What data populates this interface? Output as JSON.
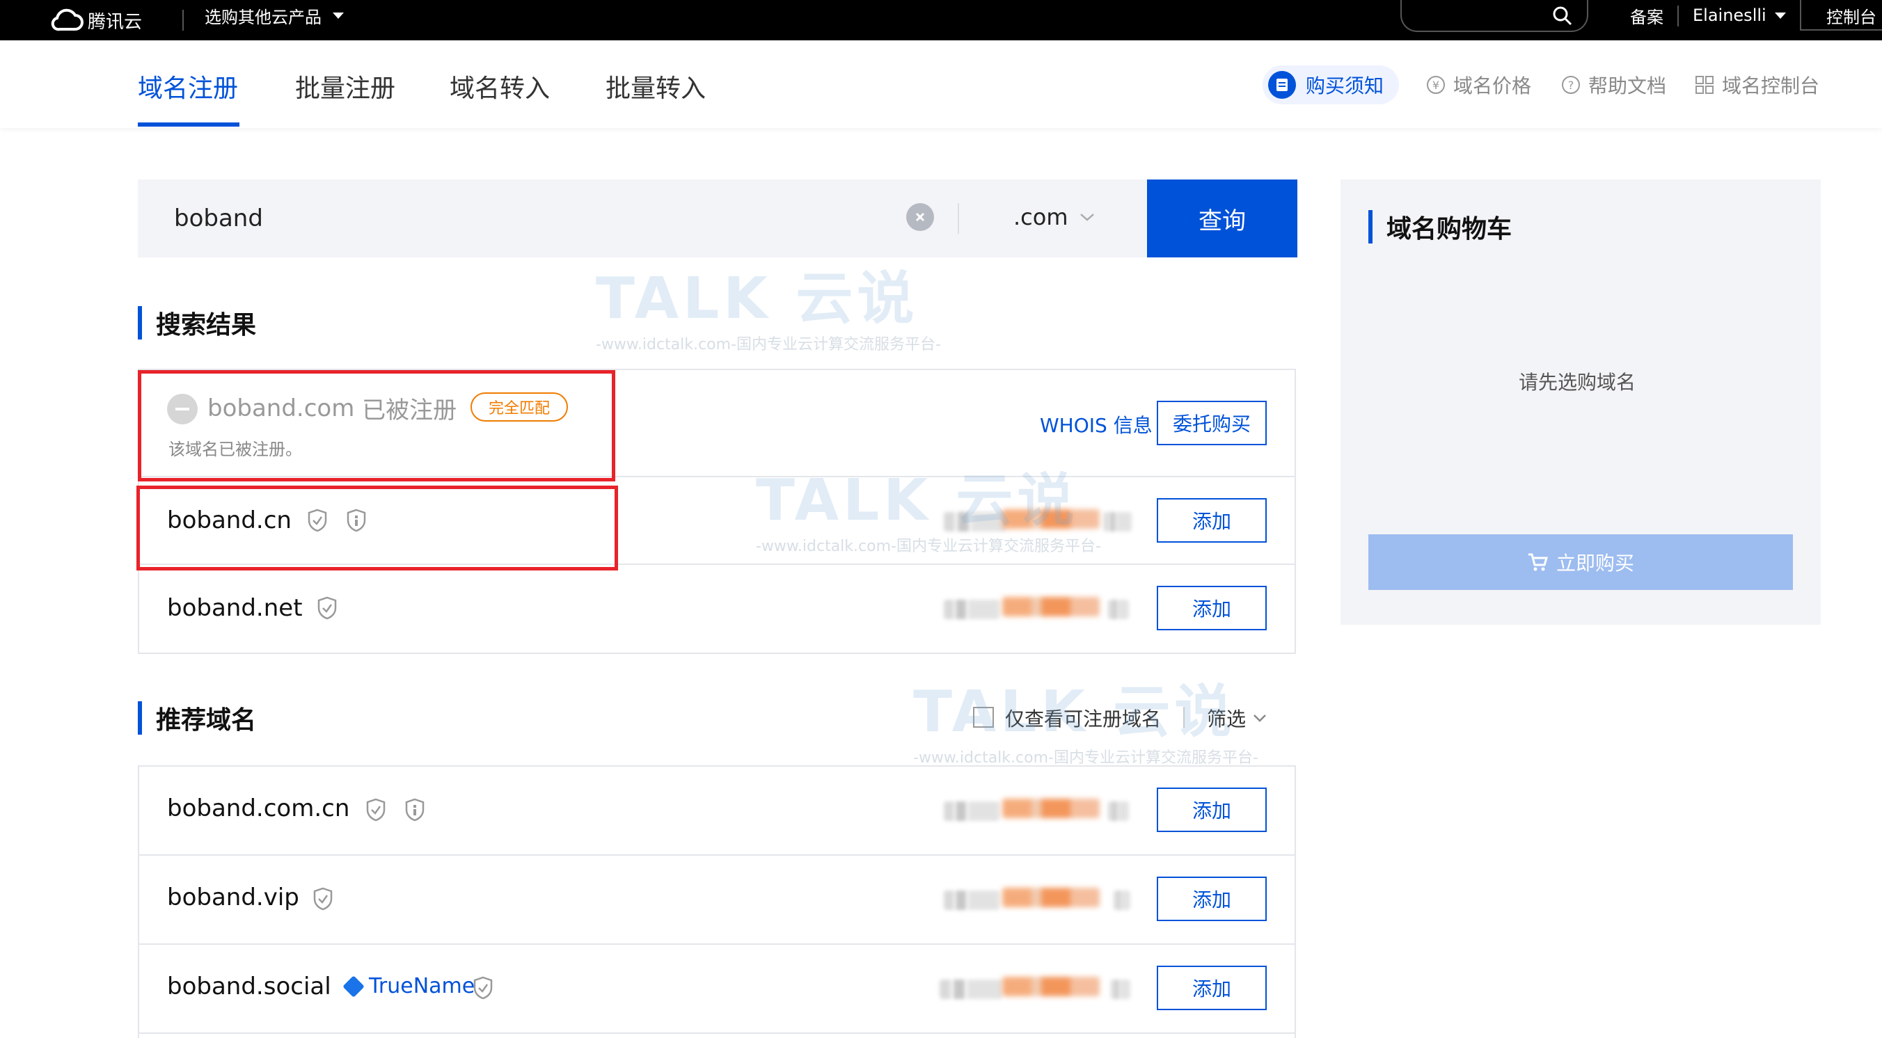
{
  "topbar": {
    "brand": "腾讯云",
    "products_menu": "选购其他云产品",
    "filing": "备案",
    "username": "Elaineslli",
    "console": "控制台"
  },
  "tabs": [
    {
      "label": "域名注册",
      "active": true
    },
    {
      "label": "批量注册",
      "active": false
    },
    {
      "label": "域名转入",
      "active": false
    },
    {
      "label": "批量转入",
      "active": false
    }
  ],
  "header_links": {
    "notice": "购买须知",
    "price": "域名价格",
    "help": "帮助文档",
    "console": "域名控制台"
  },
  "search": {
    "value": "boband",
    "suffix": ".com",
    "button": "查询"
  },
  "results": {
    "title": "搜索结果",
    "registered": {
      "name": "boband.com",
      "status": "已被注册",
      "badge": "完全匹配",
      "note": "该域名已被注册。",
      "whois": "WHOIS 信息",
      "action": "委托购买"
    },
    "items": [
      {
        "name": "boband.cn",
        "action": "添加"
      },
      {
        "name": "boband.net",
        "action": "添加"
      }
    ]
  },
  "recommend": {
    "title": "推荐域名",
    "only_available": "仅查看可注册域名",
    "filter": "筛选",
    "items": [
      {
        "name": "boband.com.cn",
        "action": "添加"
      },
      {
        "name": "boband.vip",
        "action": "添加"
      },
      {
        "name": "boband.social",
        "action": "添加",
        "tag": "TrueName"
      }
    ]
  },
  "cart": {
    "title": "域名购物车",
    "empty": "请先选购域名",
    "buy": "立即购买"
  },
  "watermark": {
    "brand": "TALK 云说",
    "url": "-www.idctalk.com-国内专业云计算交流服务平台-"
  },
  "colors": {
    "primary": "#0052d9",
    "highlight_border": "#e8232a",
    "badge": "#f07c00"
  }
}
